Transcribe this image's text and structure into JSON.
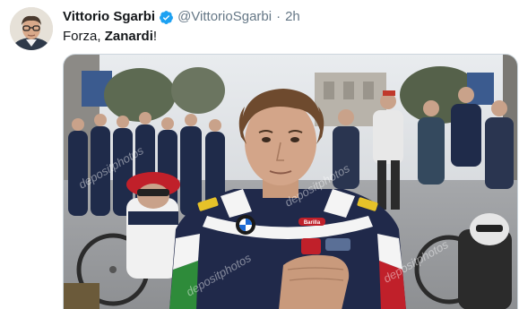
{
  "tweet": {
    "author_name": "Vittorio Sgarbi",
    "handle": "@VittorioSgarbi",
    "separator": "·",
    "time": "2h",
    "text_prefix": "Forza, ",
    "text_bold": "Zanardi",
    "text_suffix": "!",
    "verified_icon": "verified-badge-icon",
    "verified_color": "#1da1f2"
  },
  "photo": {
    "watermark": "depositphotos",
    "jersey_brand": "BMW",
    "jersey_sponsor": "Barilla"
  }
}
